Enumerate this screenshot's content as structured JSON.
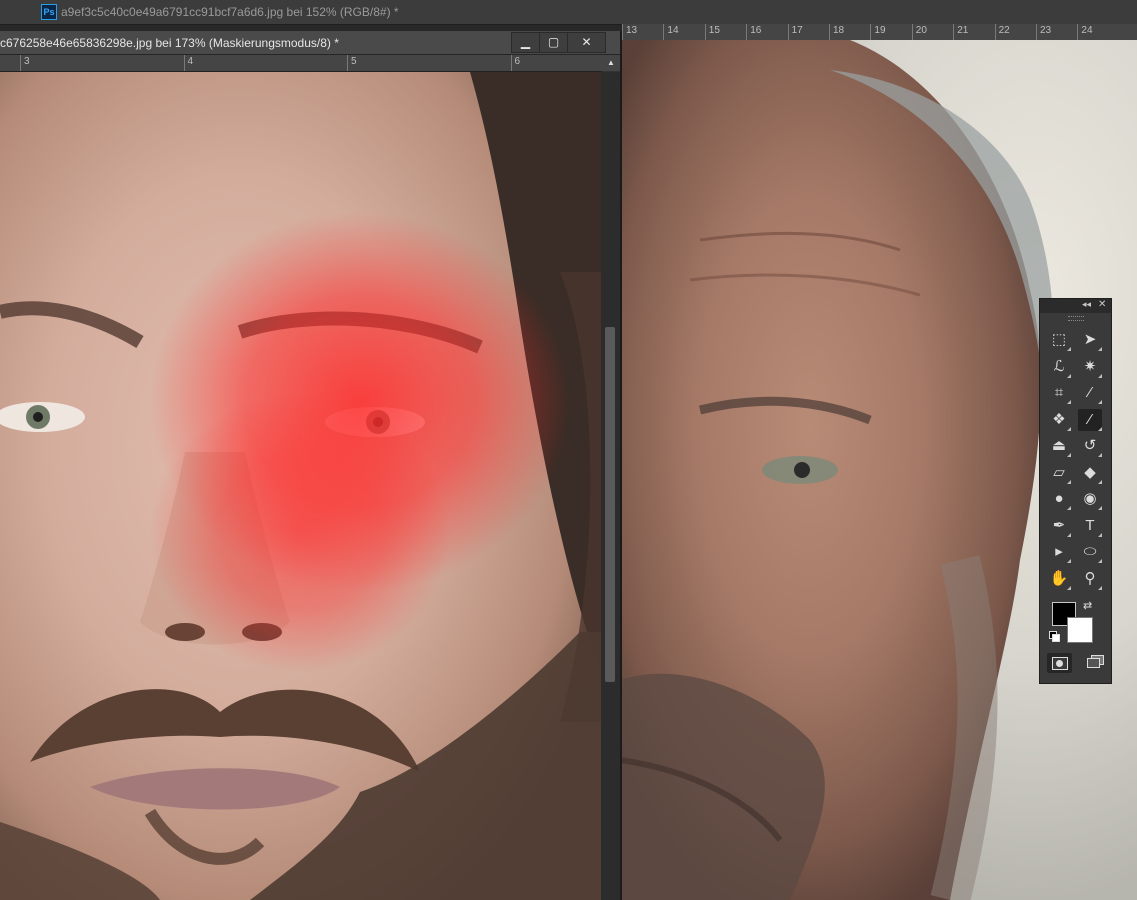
{
  "app": {
    "logo_text": "Ps"
  },
  "back_document": {
    "title": "a9ef3c5c40c0e49a6791cc91bcf7a6d6.jpg bei 152% (RGB/8#) *",
    "ruler_labels": [
      "13",
      "14",
      "15",
      "16",
      "17",
      "18",
      "19",
      "20",
      "21",
      "22",
      "23",
      "24"
    ],
    "image": "old-man-portrait"
  },
  "front_document": {
    "title": "c676258e46e65836298e.jpg bei 173% (Maskierungsmodus/8) *",
    "ruler_labels": [
      "3",
      "4",
      "5",
      "6"
    ],
    "image": "young-man-portrait-red-quick-mask",
    "window_buttons": {
      "minimize": "▁",
      "maximize": "▢",
      "close": "✕"
    }
  },
  "tools_panel": {
    "collapse": "◂◂",
    "close": "✕",
    "tools": [
      {
        "name": "marquee-tool-icon",
        "glyph": "⬚"
      },
      {
        "name": "move-tool-icon",
        "glyph": "➤"
      },
      {
        "name": "lasso-tool-icon",
        "glyph": "ℒ"
      },
      {
        "name": "magic-wand-tool-icon",
        "glyph": "✷"
      },
      {
        "name": "crop-tool-icon",
        "glyph": "⌗"
      },
      {
        "name": "eyedropper-tool-icon",
        "glyph": "⁄"
      },
      {
        "name": "healing-brush-tool-icon",
        "glyph": "❖"
      },
      {
        "name": "brush-tool-icon",
        "glyph": "⁄",
        "active": true
      },
      {
        "name": "clone-stamp-tool-icon",
        "glyph": "⏏"
      },
      {
        "name": "history-brush-tool-icon",
        "glyph": "↺"
      },
      {
        "name": "eraser-tool-icon",
        "glyph": "▱"
      },
      {
        "name": "paint-bucket-tool-icon",
        "glyph": "◆"
      },
      {
        "name": "blur-tool-icon",
        "glyph": "●"
      },
      {
        "name": "dodge-tool-icon",
        "glyph": "◉"
      },
      {
        "name": "pen-tool-icon",
        "glyph": "✒"
      },
      {
        "name": "type-tool-icon",
        "glyph": "T"
      },
      {
        "name": "path-selection-tool-icon",
        "glyph": "▸"
      },
      {
        "name": "ellipse-tool-icon",
        "glyph": "⬭"
      },
      {
        "name": "hand-tool-icon",
        "glyph": "✋"
      },
      {
        "name": "zoom-tool-icon",
        "glyph": "⚲"
      }
    ],
    "foreground_color": "#000000",
    "background_color": "#ffffff"
  },
  "colors": {
    "mask_overlay": "#ff2a2a",
    "ui_dark": "#3a3a3a"
  }
}
